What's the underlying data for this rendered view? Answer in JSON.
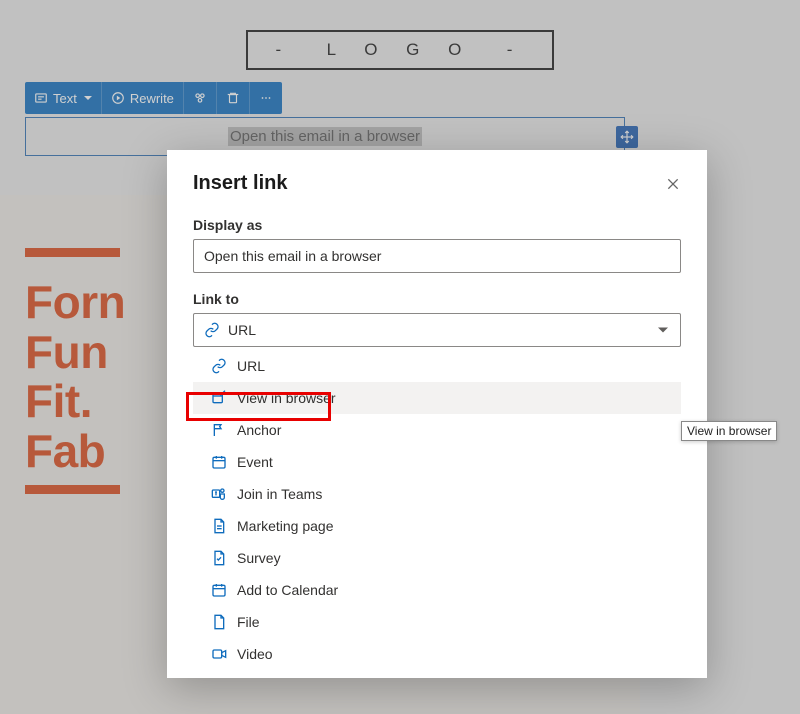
{
  "logo": {
    "text": "L O G O"
  },
  "toolbar": {
    "text_label": "Text",
    "rewrite_label": "Rewrite"
  },
  "selected_block": {
    "text": "Open this email in a browser"
  },
  "hero": {
    "line1": "Forn",
    "line2": "Fun",
    "line3": "Fit.",
    "line4": "Fab"
  },
  "modal": {
    "title": "Insert link",
    "display_as_label": "Display as",
    "display_as_value": "Open this email in a browser",
    "link_to_label": "Link to",
    "selected_option": "URL",
    "options": [
      {
        "icon": "link",
        "label": "URL"
      },
      {
        "icon": "browser",
        "label": "View in browser"
      },
      {
        "icon": "anchor",
        "label": "Anchor"
      },
      {
        "icon": "event",
        "label": "Event"
      },
      {
        "icon": "teams",
        "label": "Join in Teams"
      },
      {
        "icon": "page",
        "label": "Marketing page"
      },
      {
        "icon": "survey",
        "label": "Survey"
      },
      {
        "icon": "calendar",
        "label": "Add to Calendar"
      },
      {
        "icon": "file",
        "label": "File"
      },
      {
        "icon": "video",
        "label": "Video"
      }
    ]
  },
  "tooltip": {
    "text": "View in browser"
  }
}
